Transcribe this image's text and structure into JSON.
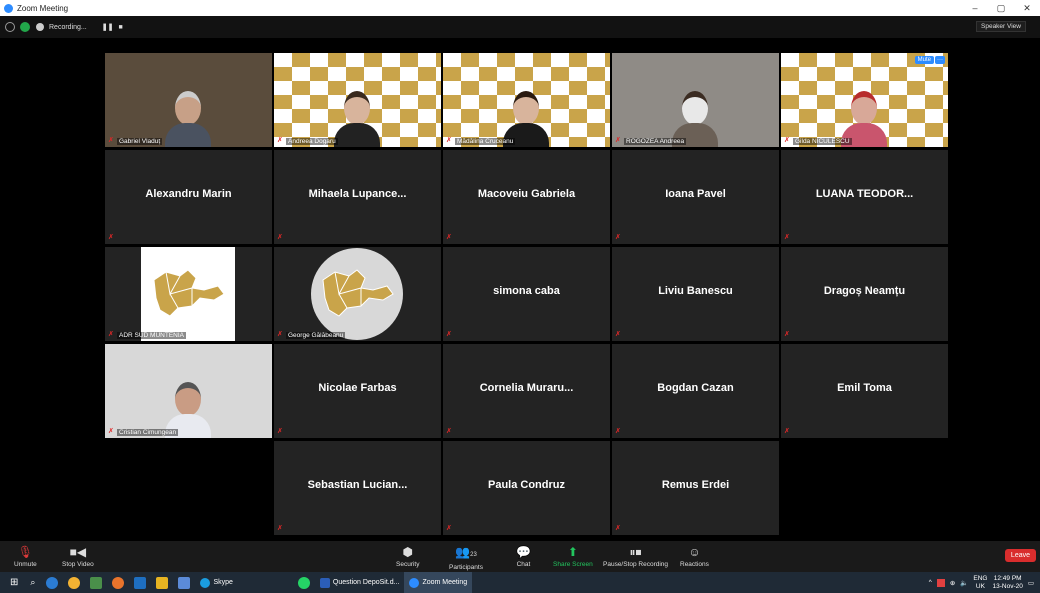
{
  "window": {
    "title": "Zoom Meeting",
    "minimize": "–",
    "maximize": "▢",
    "close": "✕"
  },
  "topbar": {
    "recording": "Recording...",
    "speaker_view": "Speaker View"
  },
  "tiles": [
    {
      "name": "Gabriel Vladuț",
      "type": "video",
      "bg": "#5a4c3c",
      "skin": "#c7a087",
      "shirt": "#4a5260",
      "hair": "#ccc"
    },
    {
      "name": "Andreea Dogaru",
      "type": "poster",
      "skin": "#d8b49c",
      "shirt": "#222",
      "hair": "#3a2a1e"
    },
    {
      "name": "Mădălina Cruceanu",
      "type": "poster",
      "skin": "#d8b49c",
      "shirt": "#1a1a1a",
      "hair": "#2a1a10"
    },
    {
      "name": "ROGOZEA Andreea",
      "type": "video",
      "bg": "#8f8b86",
      "skin": "#e8e8e8",
      "shirt": "#6b6056",
      "hair": "#3b2c22"
    },
    {
      "name": "Gilda NICULESCU",
      "type": "poster",
      "skin": "#d8a898",
      "shirt": "#c9556d",
      "hair": "#b82d2d",
      "active": true,
      "mute": "Mute",
      "more": "···"
    },
    {
      "name": "Alexandru Marin",
      "type": "name"
    },
    {
      "name": "Mihaela  Lupance...",
      "type": "name"
    },
    {
      "name": "Macoveiu Gabriela",
      "type": "name"
    },
    {
      "name": "Ioana Pavel",
      "type": "name"
    },
    {
      "name": "LUANA  TEODOR...",
      "type": "name"
    },
    {
      "name": "ADR SUD MUNTENIA",
      "type": "map"
    },
    {
      "name": "George Gălăbeanu",
      "type": "map-grey"
    },
    {
      "name": "simona caba",
      "type": "name"
    },
    {
      "name": "Liviu Banescu",
      "type": "name"
    },
    {
      "name": "Dragoș Neamțu",
      "type": "name"
    },
    {
      "name": "Cristian Cimungean",
      "type": "video",
      "bg": "#d8d8d8",
      "skin": "#c99c84",
      "shirt": "#e8eaf0",
      "hair": "#555"
    },
    {
      "name": "Nicolae Farbas",
      "type": "name"
    },
    {
      "name": "Cornelia  Muraru...",
      "type": "name"
    },
    {
      "name": "Bogdan Cazan",
      "type": "name"
    },
    {
      "name": "Emil Toma",
      "type": "name"
    },
    {
      "name": "Sebastian  Lucian...",
      "type": "name"
    },
    {
      "name": "Paula Condruz",
      "type": "name"
    },
    {
      "name": "Remus Erdei",
      "type": "name"
    }
  ],
  "controls": {
    "unmute": "Unmute",
    "stop_video": "Stop Video",
    "security": "Security",
    "participants": "Participants",
    "participants_count": "23",
    "chat": "Chat",
    "share_screen": "Share Screen",
    "pause_recording": "Pause/Stop Recording",
    "reactions": "Reactions",
    "leave": "Leave"
  },
  "taskbar": {
    "skype": "Skype",
    "question": "Question DepoSit.d...",
    "zoom": "Zoom Meeting",
    "lang": "ENG",
    "locale": "UK",
    "time": "12:49 PM",
    "date": "13-Nov-20"
  }
}
